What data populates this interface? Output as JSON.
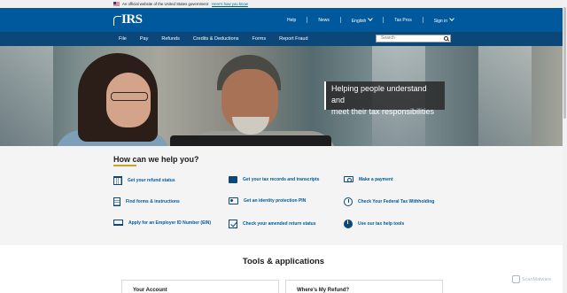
{
  "gov_banner": {
    "text": "An official website of the United States government",
    "link": "Here's how you know"
  },
  "header": {
    "logo": "IRS",
    "links": [
      "Help",
      "News",
      "English",
      "Tax Pros",
      "Sign in"
    ]
  },
  "nav": {
    "items": [
      "File",
      "Pay",
      "Refunds",
      "Credits & Deductions",
      "Forms",
      "Report Fraud"
    ],
    "search_placeholder": "Search"
  },
  "hero": {
    "caption_line1": "Helping people understand and",
    "caption_line2": "meet their tax responsibilities"
  },
  "help": {
    "title": "How can we help you?",
    "items": [
      {
        "label": "Get your refund status",
        "icon": "calendar-icon"
      },
      {
        "label": "Get your tax records and transcripts",
        "icon": "folder-icon"
      },
      {
        "label": "Make a payment",
        "icon": "money-icon"
      },
      {
        "label": "Find forms & instructions",
        "icon": "document-icon"
      },
      {
        "label": "Get an identity protection PIN",
        "icon": "id-card-icon"
      },
      {
        "label": "Check Your Federal Tax Withholding",
        "icon": "clock-icon"
      },
      {
        "label": "Apply for an Employer ID Number (EIN)",
        "icon": "laptop-icon"
      },
      {
        "label": "Check your amended return status",
        "icon": "checkbox-icon"
      },
      {
        "label": "Use our tax help tools",
        "icon": "info-icon"
      }
    ]
  },
  "tools": {
    "title": "Tools & applications",
    "cards": [
      "Your Account",
      "Where's My Refund?"
    ]
  },
  "watermark": "ScanMalware",
  "colors": {
    "header_blue": "#00599c",
    "nav_blue": "#0b4778",
    "accent_gold": "#c9a227",
    "link_blue": "#00599c"
  }
}
